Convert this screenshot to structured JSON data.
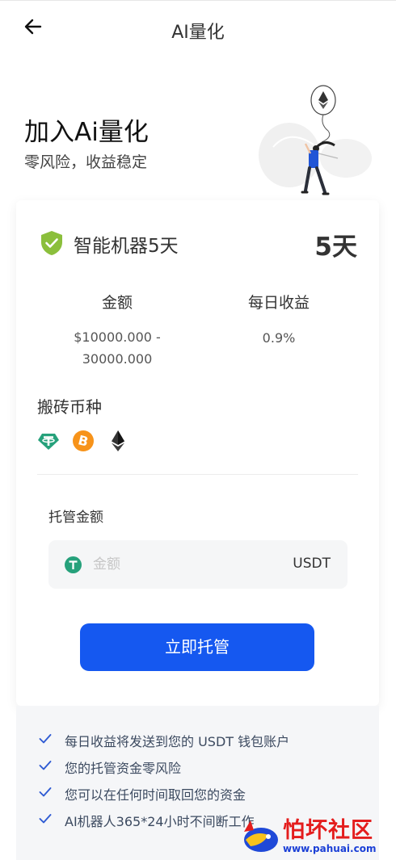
{
  "header": {
    "title": "AI量化"
  },
  "hero": {
    "title": "加入Ai量化",
    "subtitle": "零风险，收益稳定"
  },
  "plan": {
    "name": "智能机器5天",
    "days": "5天",
    "amount_label": "金额",
    "amount_value": "$10000.000 - 30000.000",
    "daily_label": "每日收益",
    "daily_value": "0.9%",
    "coins_label": "搬砖币种",
    "coins": [
      "usdt-icon",
      "bitcoin-icon",
      "ethereum-icon"
    ]
  },
  "deposit": {
    "label": "托管金额",
    "placeholder": "金额",
    "value": "",
    "unit": "USDT",
    "button": "立即托管"
  },
  "notes": [
    "每日收益将发送到您的 USDT 钱包账户",
    "您的托管资金零风险",
    "您可以在任何时间取回您的资金",
    "AI机器人365*24小时不间断工作"
  ],
  "watermark": {
    "text": "怕坏社区",
    "url": "www.pahuai.com"
  },
  "colors": {
    "primary": "#1558f0",
    "usdt": "#26a17b",
    "bitcoin": "#f7931a",
    "shield": "#8bbf3c",
    "check": "#2f5bd3"
  }
}
